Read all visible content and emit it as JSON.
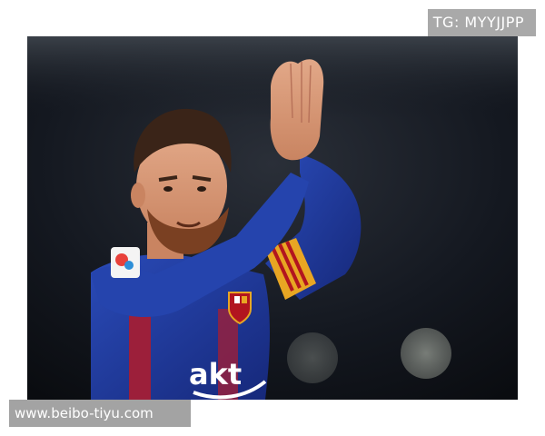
{
  "watermark_top": {
    "text": "TG: MYYJJPP"
  },
  "watermark_bottom": {
    "text": "www.beibo-tiyu.com"
  },
  "photo": {
    "shirt_text": "akt",
    "colors": {
      "background": "#0d1016",
      "jersey_blue": "#1f3a9a",
      "jersey_stripe": "#9c1f3a",
      "armband": "#e8a623",
      "skin": "#d99a78",
      "hair": "#3a2418",
      "watermark_bg": "#a9a9a9"
    }
  }
}
